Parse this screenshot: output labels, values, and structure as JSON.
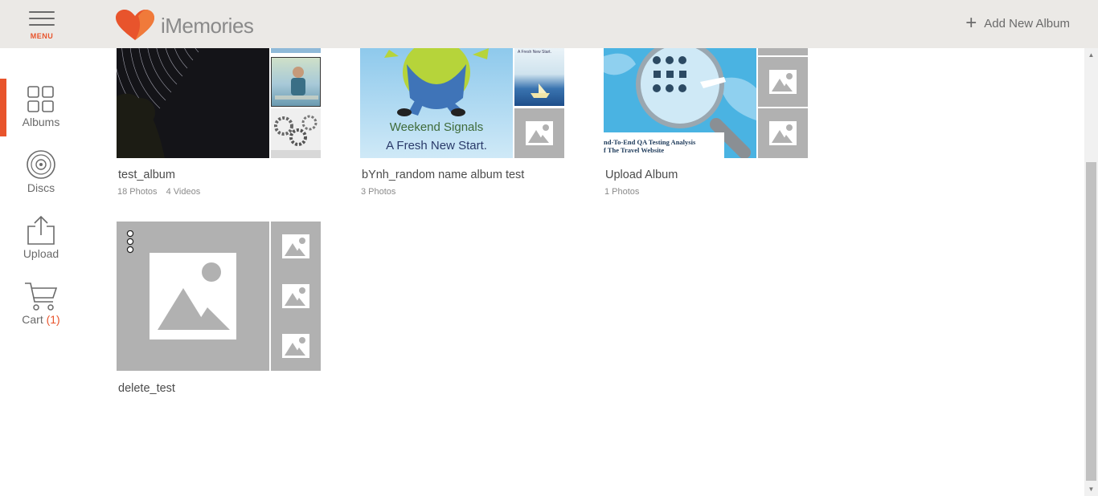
{
  "header": {
    "menu_label": "MENU",
    "brand": "iMemories",
    "add_album_label": "Add New Album"
  },
  "sidebar": {
    "items": [
      {
        "label": "Albums",
        "icon": "grid-icon",
        "active": true
      },
      {
        "label": "Discs",
        "icon": "disc-icon",
        "active": false
      },
      {
        "label": "Upload",
        "icon": "upload-icon",
        "active": false
      },
      {
        "label": "Cart",
        "icon": "cart-icon",
        "active": false,
        "count": "(1)"
      }
    ]
  },
  "albums": [
    {
      "title": "test_album",
      "photos": "18 Photos",
      "videos": "4 Videos"
    },
    {
      "title": "bYnh_random name album test",
      "photos": "3 Photos",
      "cover_caption_line1": "Weekend Signals",
      "cover_caption_line2": "A Fresh New Start.",
      "thumb_caption": "A Fresh New Start."
    },
    {
      "title": "Upload Album",
      "photos": "1 Photos",
      "cover_caption_line1": "nd-To-End QA Testing Analysis",
      "cover_caption_line2": "f The Travel Website"
    },
    {
      "title": "delete_test"
    }
  ],
  "colors": {
    "accent": "#e8542c",
    "header_bg": "#ebe9e6",
    "placeholder_bg": "#b1b1b1"
  }
}
